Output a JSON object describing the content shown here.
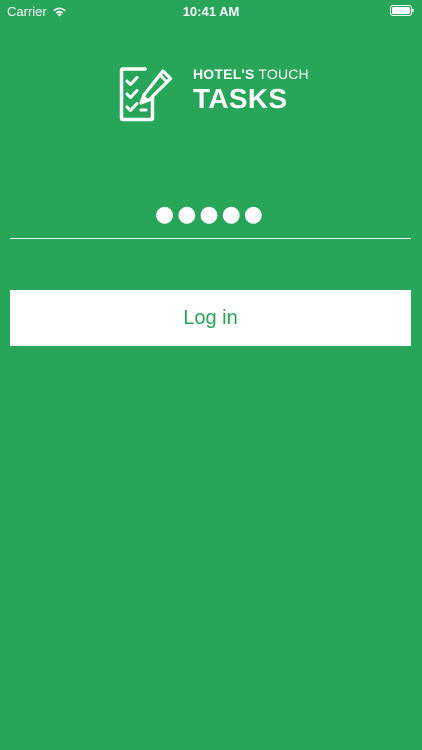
{
  "status_bar": {
    "carrier": "Carrier",
    "time": "10:41 AM",
    "wifi_icon": "wifi-icon",
    "battery_icon": "battery-icon"
  },
  "logo": {
    "icon": "clipboard-checklist-icon",
    "brand_bold": "HOTEL'S",
    "brand_light": " TOUCH",
    "title": "TASKS"
  },
  "login_form": {
    "password_value": "●●●●●",
    "login_label": "Log in"
  },
  "colors": {
    "background": "#27a65a",
    "button_background": "#ffffff",
    "button_text": "#27a65a"
  }
}
